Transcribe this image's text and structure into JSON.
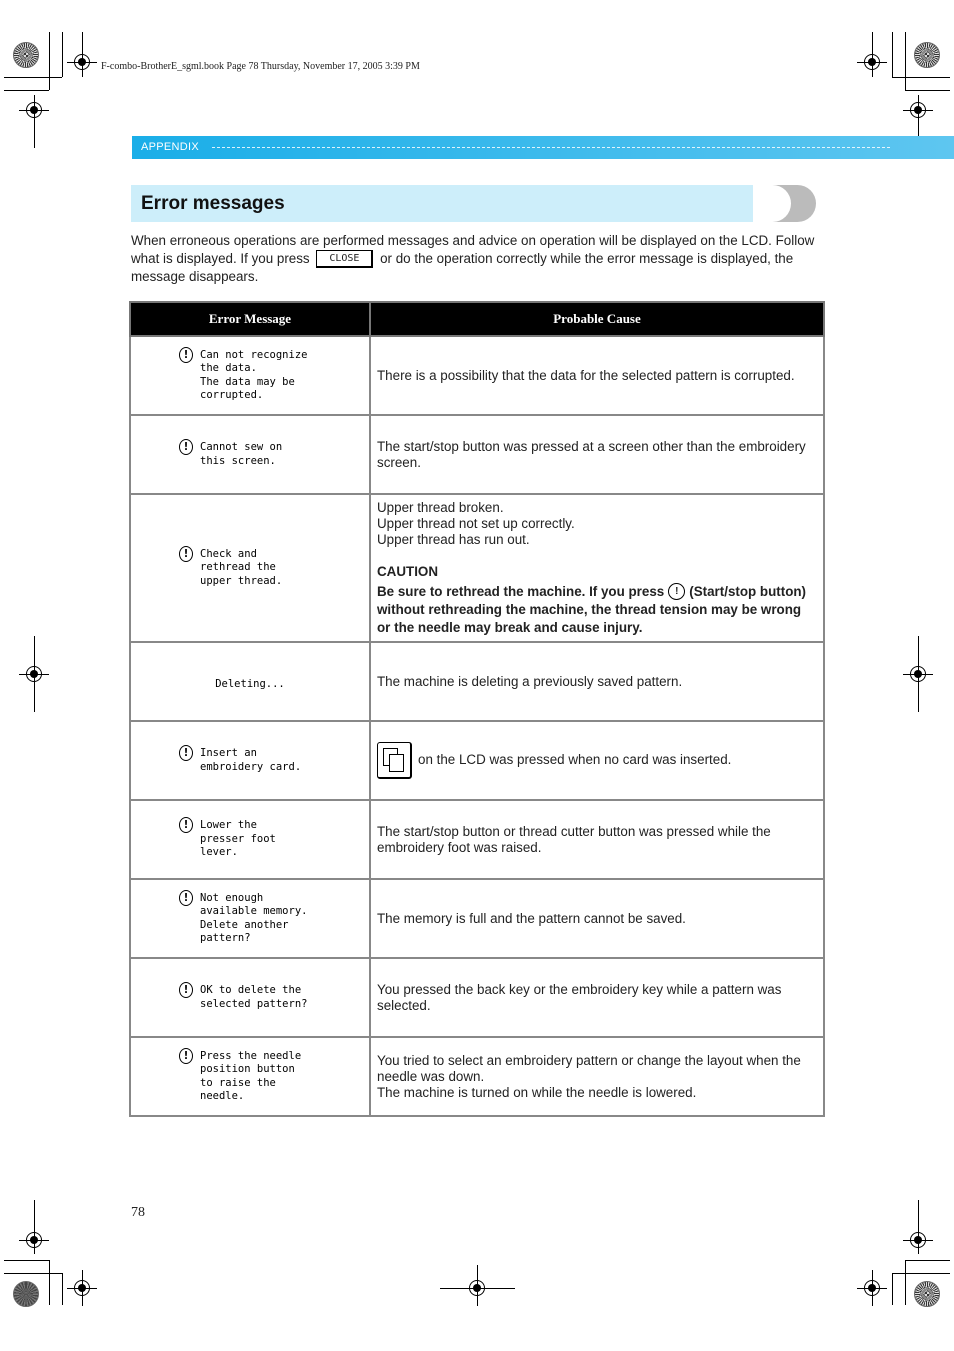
{
  "file_header": "F-combo-BrotherE_sgml.book  Page 78  Thursday, November 17, 2005  3:39 PM",
  "section_label": "APPENDIX",
  "title": "Error messages",
  "intro": {
    "part1": "When erroneous operations are performed messages and advice on operation will be displayed on the LCD. Follow what is displayed. If you press",
    "close_key": "CLOSE",
    "part2": "or do the operation correctly while the error message is displayed, the message disappears."
  },
  "table": {
    "headers": [
      "Error Message",
      "Probable Cause"
    ],
    "rows": [
      {
        "lcd": [
          "Can not recognize",
          "the data.",
          "The data may be",
          "corrupted."
        ],
        "cause": [
          "There is a possibility that the data for the selected pattern is corrupted."
        ]
      },
      {
        "lcd": [
          "Cannot sew on",
          "this screen."
        ],
        "cause": [
          "The start/stop button was pressed at a screen other than the embroidery screen."
        ]
      },
      {
        "lcd": [
          "Check and",
          "rethread the",
          "upper thread."
        ],
        "cause": [
          "Upper thread broken.",
          "Upper thread not set up correctly.",
          "Upper thread has run out."
        ],
        "caution_title": "CAUTION",
        "caution_part1": "Be sure to rethread the machine. If you press",
        "caution_part2": "(Start/stop button) without rethreading the machine, the thread tension may be wrong or the needle may break and cause injury."
      },
      {
        "lcd": [
          "Deleting..."
        ],
        "cause": [
          "The machine is deleting a previously saved pattern."
        ]
      },
      {
        "lcd": [
          "Insert an",
          "embroidery card."
        ],
        "cause": [
          "on the LCD was pressed when no card was inserted."
        ]
      },
      {
        "lcd": [
          "Lower the",
          "presser foot",
          "lever."
        ],
        "cause": [
          "The start/stop button or thread cutter button was pressed while the embroidery foot was raised."
        ]
      },
      {
        "lcd": [
          "Not enough",
          "available memory.",
          "Delete another",
          "pattern?"
        ],
        "cause": [
          "The memory is full and the pattern cannot be saved."
        ]
      },
      {
        "lcd": [
          "OK to delete the",
          "selected pattern?"
        ],
        "cause": [
          "You pressed the back key or the embroidery key while a pattern was selected."
        ]
      },
      {
        "lcd": [
          "Press the needle",
          "position button",
          "to raise the",
          "needle."
        ],
        "cause": [
          "You tried to select an embroidery pattern or change the layout when the needle was down.",
          "The machine is turned on while the needle is lowered."
        ]
      }
    ]
  },
  "icons": {
    "warning": "!",
    "start_stop": "!"
  },
  "page_number": "78",
  "colors": {
    "appendix_bar": "#1aaee8",
    "title_bar": "#cdeefa",
    "header_bg": "#000000"
  }
}
